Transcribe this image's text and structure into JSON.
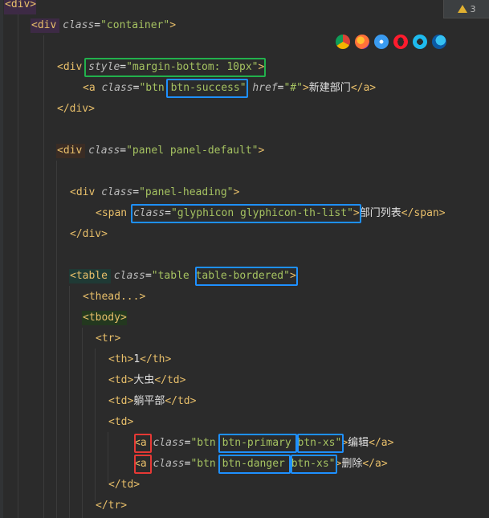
{
  "editor": {
    "warnings": {
      "count": "3",
      "icon": "warning-icon"
    },
    "browsers": [
      "chrome-icon",
      "firefox-icon",
      "safari-icon",
      "opera-icon",
      "ie-icon",
      "edge-icon"
    ],
    "lines": {
      "l1_tag": "<div>",
      "l2_open": "<div ",
      "l2_attr": "class",
      "l2_eq": "=",
      "l2_val": "\"container\"",
      "l2_close": ">",
      "l3_open": "<div ",
      "l3_attr": "style",
      "l3_eq": "=",
      "l3_val": "\"margin-bottom: 10px\"",
      "l3_close": ">",
      "l4_open": "<a ",
      "l4_attr": "class",
      "l4_eq": "=",
      "l4_val1": "\"btn ",
      "l4_val2": "btn-success",
      "l4_val3": "\"",
      "l4_attr2": " href",
      "l4_eq2": "=",
      "l4_val4": "\"#\"",
      "l4_close": ">",
      "l4_text": "新建部门",
      "l4_end": "</a>",
      "l5_tag": "</div>",
      "l6_open": "<div ",
      "l6_attr": "class",
      "l6_eq": "=",
      "l6_val": "\"panel panel-default\"",
      "l6_close": ">",
      "l7_open": "<div ",
      "l7_attr": "class",
      "l7_eq": "=",
      "l7_val": "\"panel-heading\"",
      "l7_close": ">",
      "l8_open": "<span ",
      "l8_attr": "class",
      "l8_eq": "=",
      "l8_val": "\"glyphicon glyphicon-th-list\"",
      "l8_close": ">",
      "l8_text": "部门列表",
      "l8_end": "</span>",
      "l9_tag": "</div>",
      "l10_open": "<table ",
      "l10_attr": "class",
      "l10_eq": "=",
      "l10_val1": "\"table ",
      "l10_val2": "table-bordered\"",
      "l10_close": ">",
      "l11_tag": "<thead...>",
      "l12_tag": "<tbody>",
      "l13_tag": "<tr>",
      "l14_open": "<th>",
      "l14_text": "1",
      "l14_end": "</th>",
      "l15_open": "<td>",
      "l15_text": "大虫",
      "l15_end": "</td>",
      "l16_open": "<td>",
      "l16_text": "躺平部",
      "l16_end": "</td>",
      "l17_tag": "<td>",
      "l18_lt": "<",
      "l18_a": "a",
      "l18_attr": " class",
      "l18_eq": "=",
      "l18_val1": "\"btn ",
      "l18_val2": "btn-primary",
      "l18_val3": " ",
      "l18_val4": "btn-xs",
      "l18_val5": "\"",
      "l18_close": ">",
      "l18_text": "编辑",
      "l18_end": "</a>",
      "l19_lt": "<",
      "l19_a": "a",
      "l19_attr": " class",
      "l19_eq": "=",
      "l19_val1": "\"btn ",
      "l19_val2": "btn-danger",
      "l19_val3": " ",
      "l19_val4": "btn-xs",
      "l19_val5": "\"",
      "l19_close": ">",
      "l19_text": "删除",
      "l19_end": "</a>",
      "l20_tag": "</td>",
      "l21_tag": "</tr>"
    }
  }
}
